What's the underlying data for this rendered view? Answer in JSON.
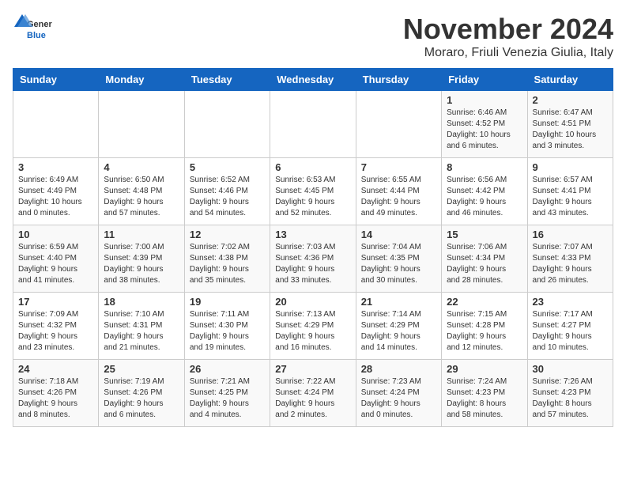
{
  "logo": {
    "general": "General",
    "blue": "Blue"
  },
  "title": "November 2024",
  "subtitle": "Moraro, Friuli Venezia Giulia, Italy",
  "headers": [
    "Sunday",
    "Monday",
    "Tuesday",
    "Wednesday",
    "Thursday",
    "Friday",
    "Saturday"
  ],
  "weeks": [
    [
      {
        "day": "",
        "info": ""
      },
      {
        "day": "",
        "info": ""
      },
      {
        "day": "",
        "info": ""
      },
      {
        "day": "",
        "info": ""
      },
      {
        "day": "",
        "info": ""
      },
      {
        "day": "1",
        "info": "Sunrise: 6:46 AM\nSunset: 4:52 PM\nDaylight: 10 hours\nand 6 minutes."
      },
      {
        "day": "2",
        "info": "Sunrise: 6:47 AM\nSunset: 4:51 PM\nDaylight: 10 hours\nand 3 minutes."
      }
    ],
    [
      {
        "day": "3",
        "info": "Sunrise: 6:49 AM\nSunset: 4:49 PM\nDaylight: 10 hours\nand 0 minutes."
      },
      {
        "day": "4",
        "info": "Sunrise: 6:50 AM\nSunset: 4:48 PM\nDaylight: 9 hours\nand 57 minutes."
      },
      {
        "day": "5",
        "info": "Sunrise: 6:52 AM\nSunset: 4:46 PM\nDaylight: 9 hours\nand 54 minutes."
      },
      {
        "day": "6",
        "info": "Sunrise: 6:53 AM\nSunset: 4:45 PM\nDaylight: 9 hours\nand 52 minutes."
      },
      {
        "day": "7",
        "info": "Sunrise: 6:55 AM\nSunset: 4:44 PM\nDaylight: 9 hours\nand 49 minutes."
      },
      {
        "day": "8",
        "info": "Sunrise: 6:56 AM\nSunset: 4:42 PM\nDaylight: 9 hours\nand 46 minutes."
      },
      {
        "day": "9",
        "info": "Sunrise: 6:57 AM\nSunset: 4:41 PM\nDaylight: 9 hours\nand 43 minutes."
      }
    ],
    [
      {
        "day": "10",
        "info": "Sunrise: 6:59 AM\nSunset: 4:40 PM\nDaylight: 9 hours\nand 41 minutes."
      },
      {
        "day": "11",
        "info": "Sunrise: 7:00 AM\nSunset: 4:39 PM\nDaylight: 9 hours\nand 38 minutes."
      },
      {
        "day": "12",
        "info": "Sunrise: 7:02 AM\nSunset: 4:38 PM\nDaylight: 9 hours\nand 35 minutes."
      },
      {
        "day": "13",
        "info": "Sunrise: 7:03 AM\nSunset: 4:36 PM\nDaylight: 9 hours\nand 33 minutes."
      },
      {
        "day": "14",
        "info": "Sunrise: 7:04 AM\nSunset: 4:35 PM\nDaylight: 9 hours\nand 30 minutes."
      },
      {
        "day": "15",
        "info": "Sunrise: 7:06 AM\nSunset: 4:34 PM\nDaylight: 9 hours\nand 28 minutes."
      },
      {
        "day": "16",
        "info": "Sunrise: 7:07 AM\nSunset: 4:33 PM\nDaylight: 9 hours\nand 26 minutes."
      }
    ],
    [
      {
        "day": "17",
        "info": "Sunrise: 7:09 AM\nSunset: 4:32 PM\nDaylight: 9 hours\nand 23 minutes."
      },
      {
        "day": "18",
        "info": "Sunrise: 7:10 AM\nSunset: 4:31 PM\nDaylight: 9 hours\nand 21 minutes."
      },
      {
        "day": "19",
        "info": "Sunrise: 7:11 AM\nSunset: 4:30 PM\nDaylight: 9 hours\nand 19 minutes."
      },
      {
        "day": "20",
        "info": "Sunrise: 7:13 AM\nSunset: 4:29 PM\nDaylight: 9 hours\nand 16 minutes."
      },
      {
        "day": "21",
        "info": "Sunrise: 7:14 AM\nSunset: 4:29 PM\nDaylight: 9 hours\nand 14 minutes."
      },
      {
        "day": "22",
        "info": "Sunrise: 7:15 AM\nSunset: 4:28 PM\nDaylight: 9 hours\nand 12 minutes."
      },
      {
        "day": "23",
        "info": "Sunrise: 7:17 AM\nSunset: 4:27 PM\nDaylight: 9 hours\nand 10 minutes."
      }
    ],
    [
      {
        "day": "24",
        "info": "Sunrise: 7:18 AM\nSunset: 4:26 PM\nDaylight: 9 hours\nand 8 minutes."
      },
      {
        "day": "25",
        "info": "Sunrise: 7:19 AM\nSunset: 4:26 PM\nDaylight: 9 hours\nand 6 minutes."
      },
      {
        "day": "26",
        "info": "Sunrise: 7:21 AM\nSunset: 4:25 PM\nDaylight: 9 hours\nand 4 minutes."
      },
      {
        "day": "27",
        "info": "Sunrise: 7:22 AM\nSunset: 4:24 PM\nDaylight: 9 hours\nand 2 minutes."
      },
      {
        "day": "28",
        "info": "Sunrise: 7:23 AM\nSunset: 4:24 PM\nDaylight: 9 hours\nand 0 minutes."
      },
      {
        "day": "29",
        "info": "Sunrise: 7:24 AM\nSunset: 4:23 PM\nDaylight: 8 hours\nand 58 minutes."
      },
      {
        "day": "30",
        "info": "Sunrise: 7:26 AM\nSunset: 4:23 PM\nDaylight: 8 hours\nand 57 minutes."
      }
    ]
  ]
}
